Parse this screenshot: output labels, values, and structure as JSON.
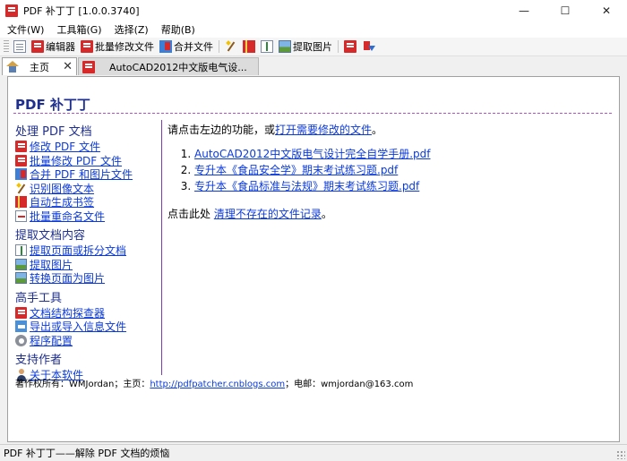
{
  "window": {
    "title": "PDF 补丁丁 [1.0.0.3740]"
  },
  "menu": [
    "文件(W)",
    "工具箱(G)",
    "选择(Z)",
    "帮助(B)"
  ],
  "toolbar": {
    "editor": "编辑器",
    "batch_modify": "批量修改文件",
    "merge": "合并文件",
    "extract_images": "提取图片"
  },
  "tabs": {
    "home": "主页",
    "doc": "AutoCAD2012中文版电气设..."
  },
  "home": {
    "app_heading": "PDF 补丁丁",
    "sections": [
      {
        "title": "处理 PDF 文档",
        "items": [
          {
            "label": "修改 PDF 文件",
            "icon": "pdf-icon"
          },
          {
            "label": "批量修改 PDF 文件",
            "icon": "pdf-icon"
          },
          {
            "label": "合并 PDF 和图片文件",
            "icon": "merge-icon"
          },
          {
            "label": "识别图像文本",
            "icon": "wand-icon"
          },
          {
            "label": "自动生成书签",
            "icon": "bookmark-icon"
          },
          {
            "label": "批量重命名文件",
            "icon": "rename-icon"
          }
        ]
      },
      {
        "title": "提取文档内容",
        "items": [
          {
            "label": "提取页面或拆分文档",
            "icon": "split-icon"
          },
          {
            "label": "提取图片",
            "icon": "image-icon"
          },
          {
            "label": "转换页面为图片",
            "icon": "image-icon"
          }
        ]
      },
      {
        "title": "高手工具",
        "items": [
          {
            "label": "文档结构探查器",
            "icon": "pdf-icon"
          },
          {
            "label": "导出或导入信息文件",
            "icon": "export-icon"
          },
          {
            "label": "程序配置",
            "icon": "gear-icon"
          }
        ]
      },
      {
        "title": "支持作者",
        "items": [
          {
            "label": "关于本软件",
            "icon": "person-icon"
          }
        ]
      }
    ],
    "intro_prefix": "请点击左边的功能，或",
    "intro_link": "打开需要修改的文件",
    "intro_suffix": "。",
    "recent_files": [
      "AutoCAD2012中文版电气设计完全自学手册.pdf",
      "专升本《食品安全学》期末考试练习题.pdf",
      "专升本《食品标准与法规》期末考试练习题.pdf"
    ],
    "cleanup_prefix": "点击此处 ",
    "cleanup_link": "清理不存在的文件记录",
    "cleanup_suffix": "。",
    "footer": {
      "copyright_prefix": "著作权所有：WMJordan；主页：",
      "homepage": "http://pdfpatcher.cnblogs.com",
      "email_prefix": "；电邮：",
      "email": "wmjordan@163.com"
    }
  },
  "status": {
    "text": "PDF 补丁丁——解除 PDF 文档的烦恼"
  }
}
